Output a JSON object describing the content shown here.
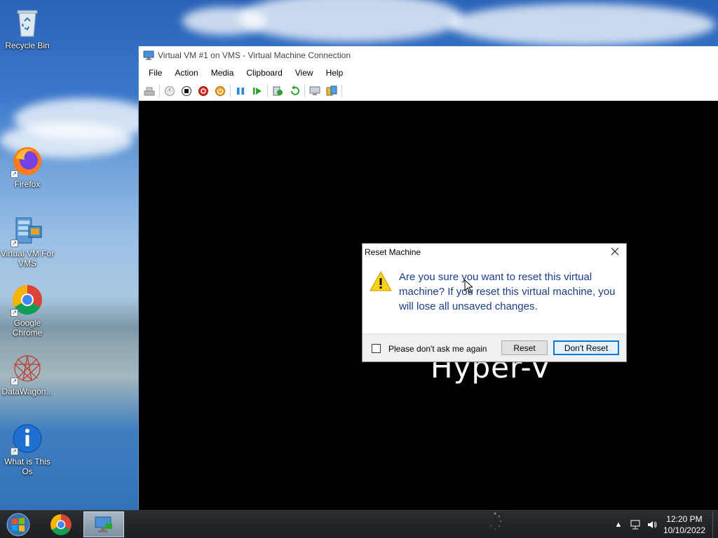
{
  "desktop": {
    "icons": [
      {
        "label": "Recycle Bin",
        "icon": "recycle-bin-icon"
      },
      {
        "label": "Firefox",
        "icon": "firefox-icon"
      },
      {
        "label": "Virtual VM For VMS",
        "icon": "hyperv-manager-icon"
      },
      {
        "label": "Google Chrome",
        "icon": "chrome-icon"
      },
      {
        "label": "DataWagon...",
        "icon": "datawagon-icon"
      },
      {
        "label": "What is This Os",
        "icon": "info-icon"
      }
    ]
  },
  "vm_window": {
    "title": "Virtual VM #1 on VMS - Virtual Machine Connection",
    "menu": [
      "File",
      "Action",
      "Media",
      "Clipboard",
      "View",
      "Help"
    ],
    "toolbar_icons": [
      "ctrl-alt-del-icon",
      "start-icon",
      "turn-off-icon",
      "shutdown-icon",
      "power-icon",
      "pause-icon",
      "resume-icon",
      "checkpoint-icon",
      "revert-icon",
      "enhanced-session-icon",
      "share-icon"
    ],
    "screen_text": "Hyper-V"
  },
  "dialog": {
    "title": "Reset Machine",
    "message": "Are you sure you want to reset this virtual machine? If you reset this virtual machine, you will lose all unsaved changes.",
    "checkbox_label": "Please don't ask me again",
    "reset_label": "Reset",
    "dont_reset_label": "Don't Reset"
  },
  "taskbar": {
    "time": "12:20 PM",
    "date": "10/10/2022"
  },
  "colors": {
    "accent": "#0078d7",
    "dialog_text": "#1c3d8c"
  }
}
